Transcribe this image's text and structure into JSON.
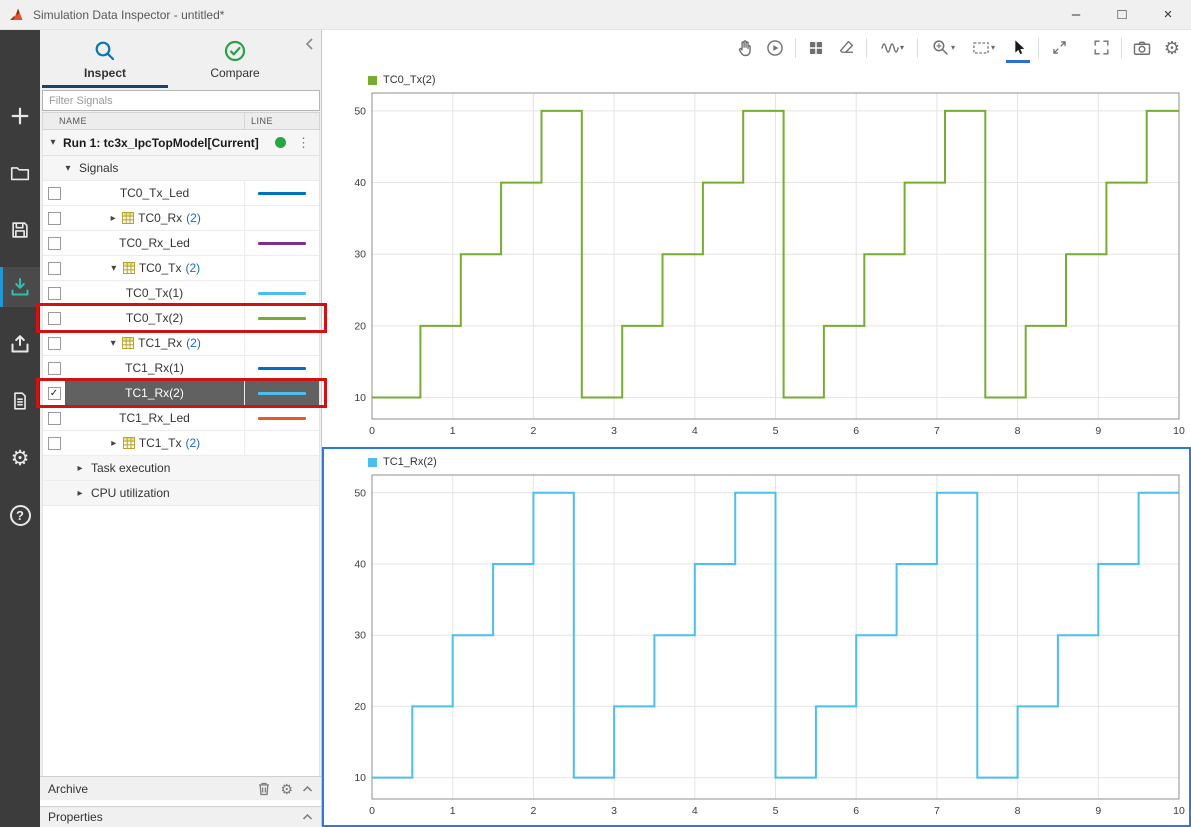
{
  "window": {
    "title": "Simulation Data Inspector - untitled*",
    "controls": {
      "minimize": "–",
      "maximize": "□",
      "close": "×"
    }
  },
  "left_toolbar": {
    "items": [
      "add",
      "open",
      "save",
      "import",
      "export",
      "create-report",
      "preferences",
      "help"
    ],
    "active_item": "import",
    "gear_glyph": "⚙",
    "help_glyph": "?"
  },
  "sidebar": {
    "tabs": [
      {
        "label": "Inspect",
        "active": true
      },
      {
        "label": "Compare",
        "active": false
      }
    ],
    "filter_placeholder": "Filter Signals",
    "columns": {
      "name": "NAME",
      "line": "LINE"
    },
    "run": {
      "label": "Run 1: tc3x_IpcTopModel[Current]",
      "status_color": "#23a845",
      "menu_glyph": "⋮",
      "expander": "▾"
    },
    "expander_glyphs": {
      "down": "▾",
      "right": "▸"
    },
    "checkbox_check_glyph": "✓",
    "rows": [
      {
        "kind": "group",
        "label": "Signals",
        "expander": "down",
        "indent": 1
      },
      {
        "kind": "signal",
        "label": "TC0_Tx_Led",
        "checkbox": "unchecked",
        "line_color": "#0072BD"
      },
      {
        "kind": "bus",
        "label": "TC0_Rx",
        "count": "(2)",
        "expander": "right",
        "checkbox": "unchecked"
      },
      {
        "kind": "signal",
        "label": "TC0_Rx_Led",
        "checkbox": "unchecked",
        "line_color": "#7E2F8E"
      },
      {
        "kind": "bus",
        "label": "TC0_Tx",
        "count": "(2)",
        "expander": "down",
        "checkbox": "unchecked"
      },
      {
        "kind": "signal",
        "label": "TC0_Tx(1)",
        "checkbox": "unchecked",
        "line_color": "#4DBEEE"
      },
      {
        "kind": "signal",
        "label": "TC0_Tx(2)",
        "checkbox": "unchecked",
        "line_color": "#77AC30",
        "annotated": true
      },
      {
        "kind": "bus",
        "label": "TC1_Rx",
        "count": "(2)",
        "expander": "down",
        "checkbox": "unchecked"
      },
      {
        "kind": "signal",
        "label": "TC1_Rx(1)",
        "checkbox": "unchecked",
        "line_color": "#0072BD"
      },
      {
        "kind": "signal",
        "label": "TC1_Rx(2)",
        "checkbox": "checked",
        "line_color": "#4DBEEE",
        "selected": true,
        "annotated": true
      },
      {
        "kind": "signal",
        "label": "TC1_Rx_Led",
        "checkbox": "unchecked",
        "line_color": "#E8582B"
      },
      {
        "kind": "bus",
        "label": "TC1_Tx",
        "count": "(2)",
        "expander": "right",
        "checkbox": "unchecked"
      },
      {
        "kind": "group",
        "label": "Task execution",
        "expander": "right",
        "indent": 2
      },
      {
        "kind": "group",
        "label": "CPU utilization",
        "expander": "right",
        "indent": 2
      }
    ],
    "archive_label": "Archive",
    "properties_label": "Properties"
  },
  "plot_toolbar": {
    "items": [
      {
        "name": "pan"
      },
      {
        "name": "replay"
      },
      {
        "name": "subplot-layout"
      },
      {
        "name": "clear-subplots"
      },
      {
        "name": "line-style",
        "dropdown": true
      },
      {
        "name": "zoom",
        "dropdown": true
      },
      {
        "name": "zoom-region",
        "dropdown": true
      },
      {
        "name": "pointer",
        "active": true
      },
      {
        "name": "maximize-axes"
      },
      {
        "name": "fullscreen"
      },
      {
        "name": "snapshot"
      },
      {
        "name": "settings"
      }
    ],
    "active_item": "pointer",
    "caret_glyph": "▾",
    "gear_glyph": "⚙"
  },
  "annotations": {
    "color": "#d01212",
    "boxes": [
      "TC0_Tx(2)",
      "TC1_Rx(2)"
    ]
  },
  "chart_data": [
    {
      "type": "step-line",
      "title": "TC0_Tx(2)",
      "color": "#77AC30",
      "xlabel": "",
      "ylabel": "",
      "xlim": [
        0,
        10
      ],
      "ylim": [
        7,
        52.5
      ],
      "xticks": [
        0,
        1,
        2,
        3,
        4,
        5,
        6,
        7,
        8,
        9,
        10
      ],
      "yticks": [
        10,
        20,
        30,
        40,
        50
      ],
      "grid": true,
      "legend_position": "top-left",
      "x_breaks": [
        0,
        0.6,
        1.1,
        1.6,
        2.1,
        2.6,
        3.1,
        3.6,
        4.1,
        4.6,
        5.1,
        5.6,
        6.1,
        6.6,
        7.1,
        7.6,
        8.1,
        8.6,
        9.1,
        9.6
      ],
      "values": [
        10,
        20,
        30,
        40,
        50,
        10,
        20,
        30,
        40,
        50,
        10,
        20,
        30,
        40,
        50,
        10,
        20,
        30,
        40,
        50
      ],
      "selected": false
    },
    {
      "type": "step-line",
      "title": "TC1_Rx(2)",
      "color": "#4DBEEE",
      "xlabel": "",
      "ylabel": "",
      "xlim": [
        0,
        10
      ],
      "ylim": [
        7,
        52.5
      ],
      "xticks": [
        0,
        1,
        2,
        3,
        4,
        5,
        6,
        7,
        8,
        9,
        10
      ],
      "yticks": [
        10,
        20,
        30,
        40,
        50
      ],
      "grid": true,
      "legend_position": "top-left",
      "x_breaks": [
        0,
        0.5,
        1.0,
        1.5,
        2.0,
        2.5,
        3.0,
        3.5,
        4.0,
        4.5,
        5.0,
        5.5,
        6.0,
        6.5,
        7.0,
        7.5,
        8.0,
        8.5,
        9.0,
        9.5
      ],
      "values": [
        10,
        20,
        30,
        40,
        50,
        10,
        20,
        30,
        40,
        50,
        10,
        20,
        30,
        40,
        50,
        10,
        20,
        30,
        40,
        50
      ],
      "selected": true
    }
  ]
}
